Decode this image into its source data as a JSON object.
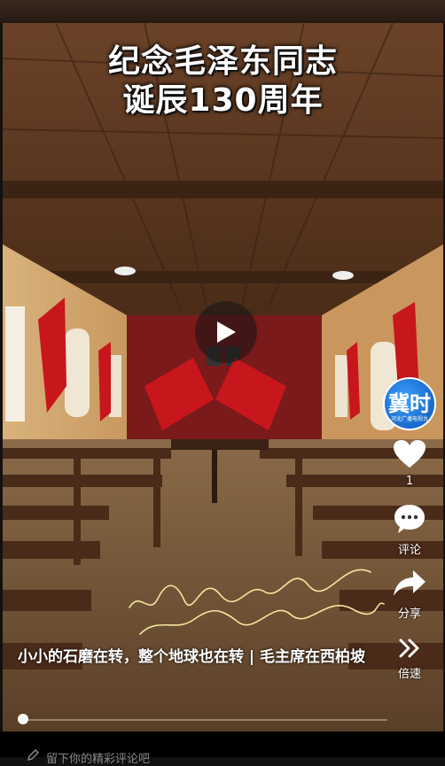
{
  "video": {
    "title_line1": "纪念毛泽东同志",
    "title_line2": "诞辰130周年",
    "caption": "小小的石磨在转，整个地球也在转 | 毛主席在西柏坡",
    "progress": 0.01
  },
  "author": {
    "avatar_glyph": "冀时",
    "avatar_sub": "河北广播电视台"
  },
  "actions": {
    "like_count": "1",
    "comment_label": "评论",
    "share_label": "分享",
    "speed_label": "倍速"
  },
  "comment_input": {
    "placeholder": "留下你的精彩评论吧"
  },
  "icons": {
    "play": "play-icon",
    "like": "heart-icon",
    "comment": "comment-bubble-icon",
    "share": "share-arrow-icon",
    "speed": "double-chevron-icon",
    "pencil": "pencil-icon"
  },
  "colors": {
    "overlay_text": "#ffffff",
    "banner_red": "#c8161d",
    "background": "#111111"
  }
}
